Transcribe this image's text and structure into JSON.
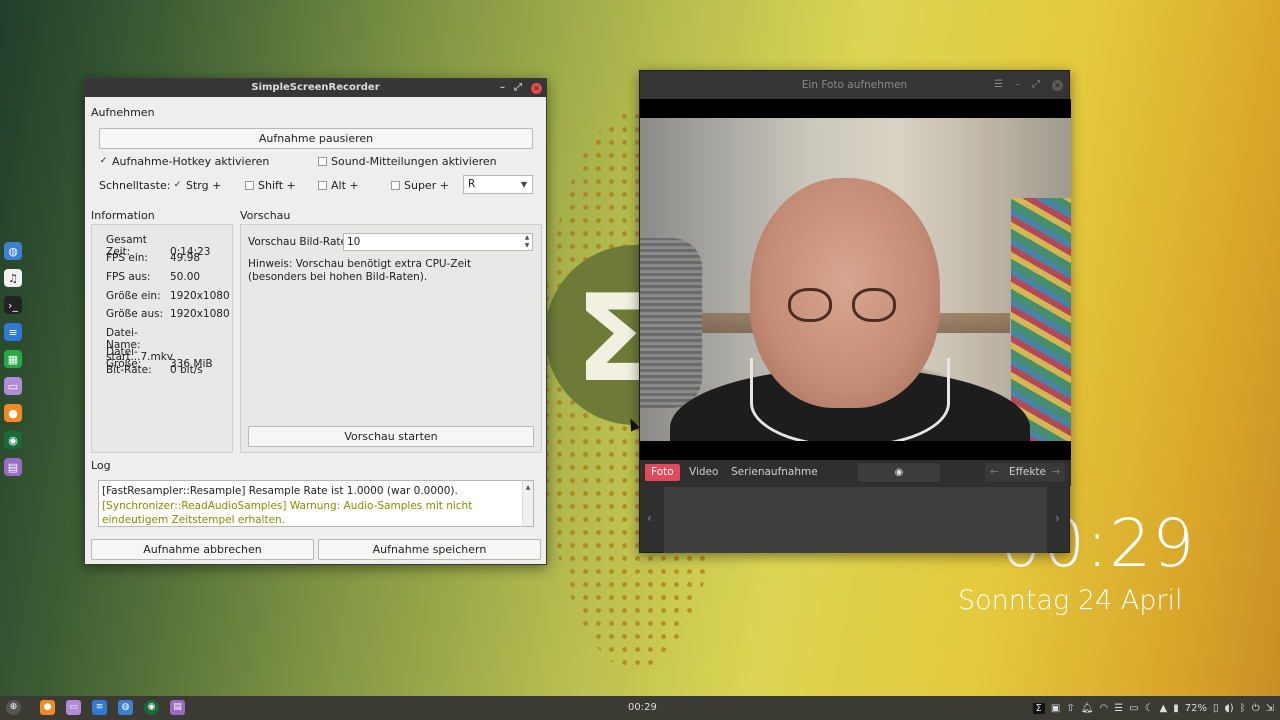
{
  "desktop": {
    "clock_time": "00:29",
    "clock_date": "Sonntag 24 April"
  },
  "ssr": {
    "title": "SimpleScreenRecorder",
    "record_section": "Aufnehmen",
    "pause_button": "Aufnahme pausieren",
    "hotkey_enable": "Aufnahme-Hotkey aktivieren",
    "hotkey_enable_checked": true,
    "sound_notify": "Sound-Mitteilungen aktivieren",
    "sound_notify_checked": false,
    "shortcut_label": "Schnelltaste:",
    "mod_ctrl": "Strg +",
    "mod_ctrl_checked": true,
    "mod_shift": "Shift +",
    "mod_alt": "Alt +",
    "mod_super": "Super +",
    "key_value": "R",
    "info_section": "Information",
    "info": [
      {
        "k": "Gesamt Zeit:",
        "v": "0:14:23"
      },
      {
        "k": "FPS ein:",
        "v": "49.98"
      },
      {
        "k": "FPS aus:",
        "v": "50.00"
      },
      {
        "k": "Größe ein:",
        "v": "1920x1080"
      },
      {
        "k": "Größe aus:",
        "v": "1920x1080"
      },
      {
        "k": "Datei-Name:",
        "v": "start...7.mkv"
      },
      {
        "k": "Datei-Größe:",
        "v": "336 MiB"
      },
      {
        "k": "Bit-Rate:",
        "v": "0 bit/s"
      }
    ],
    "preview_section": "Vorschau",
    "preview_rate_label": "Vorschau Bild-Rate:",
    "preview_rate_value": "10",
    "preview_hint": "Hinweis: Vorschau benötigt extra CPU-Zeit (besonders bei hohen Bild-Raten).",
    "preview_start": "Vorschau starten",
    "log_section": "Log",
    "log_lines": [
      "[FastResampler::Resample] Resample Rate ist 1.0000 (war 0.0000).",
      "[Synchronizer::ReadAudioSamples] Warnung: Audio-Samples mit nicht eindeutigem Zeitstempel erhalten."
    ],
    "cancel_button": "Aufnahme abbrechen",
    "save_button": "Aufnahme speichern"
  },
  "cheese": {
    "title": "Ein Foto aufnehmen",
    "tab_photo": "Foto",
    "tab_video": "Video",
    "tab_burst": "Serienaufnahme",
    "effects": "Effekte"
  },
  "taskbar": {
    "clock": "00:29",
    "battery": "72%"
  },
  "colors": {
    "accent_red": "#e04a5b",
    "log_warning": "#8a8a00"
  }
}
